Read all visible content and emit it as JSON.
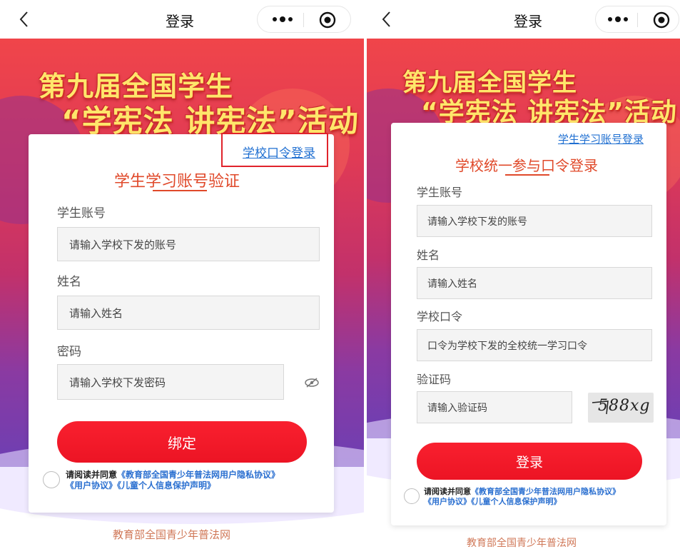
{
  "left": {
    "nav": {
      "title": "登录"
    },
    "banner": {
      "line1": "第九届全国学生",
      "line2": "“学宪法 讲宪法”活动"
    },
    "card": {
      "switch_link": "学校口令登录",
      "heading": "学生学习账号验证",
      "fields": [
        {
          "label": "学生账号",
          "placeholder": "请输入学校下发的账号"
        },
        {
          "label": "姓名",
          "placeholder": "请输入姓名"
        },
        {
          "label": "密码",
          "placeholder": "请输入学校下发密码"
        }
      ],
      "button": "绑定",
      "agreement": {
        "prefix": "请阅读并同意",
        "privacy": "《教育部全国青少年普法网用户隐私协议》",
        "user": "《用户协议》",
        "children": "《儿童个人信息保护声明》"
      }
    },
    "footer": "教育部全国青少年普法网"
  },
  "right": {
    "nav": {
      "title": "登录"
    },
    "banner": {
      "line1": "第九届全国学生",
      "line2": "“学宪法 讲宪法”活动"
    },
    "card": {
      "switch_link": "学生学习账号登录",
      "heading": "学校统一参与口令登录",
      "fields": [
        {
          "label": "学生账号",
          "placeholder": "请输入学校下发的账号"
        },
        {
          "label": "姓名",
          "placeholder": "请输入姓名"
        },
        {
          "label": "学校口令",
          "placeholder": "口令为学校下发的全校统一学习口令"
        },
        {
          "label": "验证码",
          "placeholder": "请输入验证码"
        }
      ],
      "captcha": "588xg",
      "button": "登录",
      "agreement": {
        "prefix": "请阅读并同意",
        "privacy": "《教育部全国青少年普法网用户隐私协议》",
        "user": "《用户协议》",
        "children": "《儿童个人信息保护声明》"
      }
    },
    "footer": "教育部全国青少年普法网"
  },
  "colors": {
    "accent": "#ec1424",
    "heading": "#e0492a",
    "link": "#1f6fd1",
    "banner_text": "#ffe66b",
    "highlight": "#e0232b"
  },
  "icons": {
    "back": "chevron-left-icon",
    "more": "more-dots-icon",
    "close": "target-circle-icon",
    "password": "eye-slash-icon"
  }
}
